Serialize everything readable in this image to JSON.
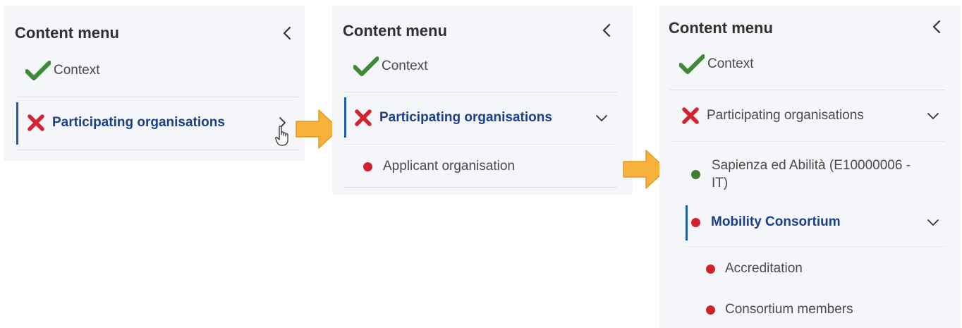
{
  "colors": {
    "check": "#3e8a35",
    "cross": "#d2232f",
    "dot_red": "#d41f2c",
    "dot_green": "#3f7d2f",
    "accent": "#1a3f8c",
    "arrow": "#f7b23b"
  },
  "panels": [
    {
      "title": "Content menu",
      "items": [
        {
          "label": "Context",
          "status": "check-icon"
        },
        {
          "label": "Participating organisations",
          "status": "cross-icon",
          "chevron": "chevron-right-icon"
        }
      ]
    },
    {
      "title": "Content menu",
      "items": [
        {
          "label": "Context",
          "status": "check-icon"
        },
        {
          "label": "Participating organisations",
          "status": "cross-icon",
          "chevron": "chevron-down-icon"
        },
        {
          "label": "Applicant organisation",
          "status": "red-dot-icon"
        }
      ]
    },
    {
      "title": "Content menu",
      "items": [
        {
          "label": "Context",
          "status": "check-icon"
        },
        {
          "label": "Participating organisations",
          "status": "cross-icon",
          "chevron": "chevron-down-icon"
        },
        {
          "label_line1": "Sapienza ed Abilità (E10000006 -",
          "label_line2": "IT)",
          "status": "green-dot-icon"
        },
        {
          "label": "Mobility Consortium",
          "status": "red-dot-icon",
          "chevron": "chevron-down-icon"
        },
        {
          "label": "Accreditation",
          "status": "red-dot-icon"
        },
        {
          "label": "Consortium members",
          "status": "red-dot-icon"
        }
      ]
    }
  ]
}
